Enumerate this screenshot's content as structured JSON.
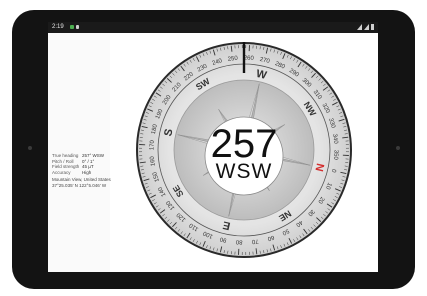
{
  "status_bar": {
    "time": "2:19"
  },
  "info_panel": {
    "rows": [
      {
        "label": "True heading",
        "value": "257° WSW"
      },
      {
        "label": "Pitch / Roll",
        "value": "0° / 1°"
      },
      {
        "label": "Field strength",
        "value": "45 µT"
      },
      {
        "label": "Accuracy",
        "value": "High"
      }
    ],
    "address": "Mountain View, United States",
    "coordinates": "37°25.035' N 122°5.046' W"
  },
  "compass": {
    "heading_value": "257",
    "heading_direction": "WSW",
    "heading_degrees": 257,
    "cardinal_labels": [
      {
        "text": "N",
        "color": "#d32f2f"
      },
      {
        "text": "NE",
        "color": "#333333"
      },
      {
        "text": "E",
        "color": "#333333"
      },
      {
        "text": "SE",
        "color": "#333333"
      },
      {
        "text": "S",
        "color": "#333333"
      },
      {
        "text": "SW",
        "color": "#333333"
      },
      {
        "text": "W",
        "color": "#333333"
      },
      {
        "text": "NW",
        "color": "#333333"
      }
    ],
    "degree_labels": [
      "0",
      "10",
      "20",
      "30",
      "40",
      "50",
      "60",
      "70",
      "80",
      "90",
      "100",
      "110",
      "120",
      "130",
      "140",
      "150",
      "160",
      "170",
      "180",
      "190",
      "200",
      "210",
      "220",
      "230",
      "240",
      "250",
      "260",
      "270",
      "280",
      "290",
      "300",
      "310",
      "320",
      "330",
      "340",
      "350"
    ]
  }
}
